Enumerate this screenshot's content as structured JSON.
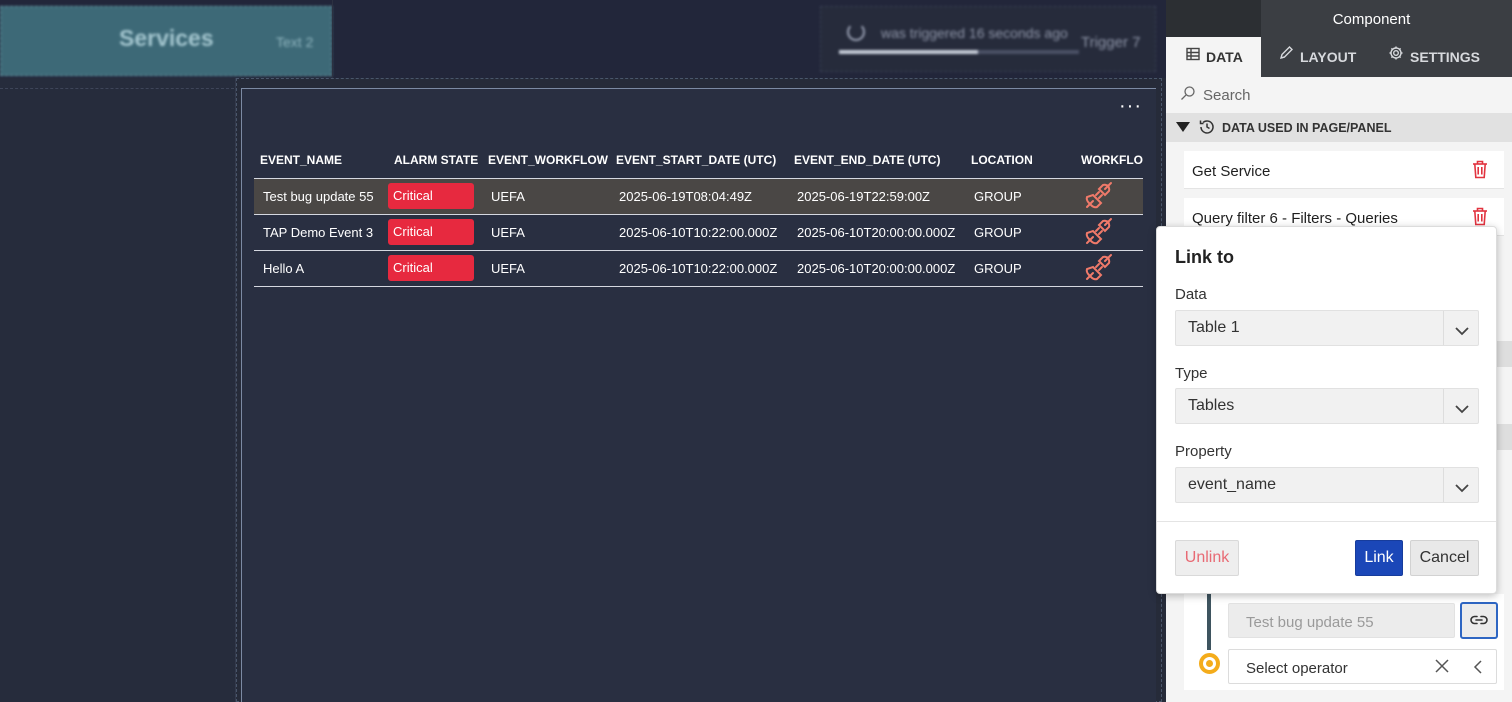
{
  "canvas": {
    "services_tile": {
      "title": "Services",
      "label": "Text 2"
    },
    "trigger_tile": {
      "status": "was triggered 16 seconds ago",
      "label": "Trigger 7",
      "progress": 0.58
    },
    "more_menu": "···"
  },
  "table": {
    "columns": [
      "EVENT_NAME",
      "ALARM STATE",
      "EVENT_WORKFLOW",
      "EVENT_START_DATE (UTC)",
      "EVENT_END_DATE (UTC)",
      "LOCATION",
      "WORKFLOW"
    ],
    "rows": [
      {
        "event_name": "Test bug update 55",
        "alarm_state": "Critical",
        "event_workflow": "UEFA",
        "start": "2025-06-19T08:04:49Z",
        "end": "2025-06-19T22:59:00Z",
        "location": "GROUP",
        "workflow_icon": "unplugged-icon"
      },
      {
        "event_name": "TAP Demo Event 3",
        "alarm_state": "Critical",
        "event_workflow": "UEFA",
        "start": "2025-06-10T10:22:00.000Z",
        "end": "2025-06-10T20:00:00.000Z",
        "location": "GROUP",
        "workflow_icon": "unplugged-icon"
      },
      {
        "event_name": "Hello A",
        "alarm_state": "Critical",
        "event_workflow": "UEFA",
        "start": "2025-06-10T10:22:00.000Z",
        "end": "2025-06-10T20:00:00.000Z",
        "location": "GROUP",
        "workflow_icon": "unplugged-icon"
      }
    ],
    "colors": {
      "critical": "#e7293f",
      "selected_row": "#4a4745",
      "plug": "#f07a6a"
    }
  },
  "sidebar": {
    "title": "Component",
    "tabs": [
      {
        "label": "DATA",
        "icon": "table-icon"
      },
      {
        "label": "LAYOUT",
        "icon": "pencil-icon"
      },
      {
        "label": "SETTINGS",
        "icon": "gear-icon"
      }
    ],
    "search_placeholder": "Search",
    "section_label": "DATA USED IN PAGE/PANEL",
    "items": [
      {
        "label": "Get Service"
      },
      {
        "label": "Query filter 6 - Filters - Queries"
      }
    ],
    "bottom": {
      "linked_value": "Test bug update 55",
      "operator_placeholder": "Select operator"
    }
  },
  "popup": {
    "title": "Link to",
    "data_label": "Data",
    "data_value": "Table 1",
    "type_label": "Type",
    "type_value": "Tables",
    "property_label": "Property",
    "property_value": "event_name",
    "unlink": "Unlink",
    "link": "Link",
    "cancel": "Cancel"
  }
}
